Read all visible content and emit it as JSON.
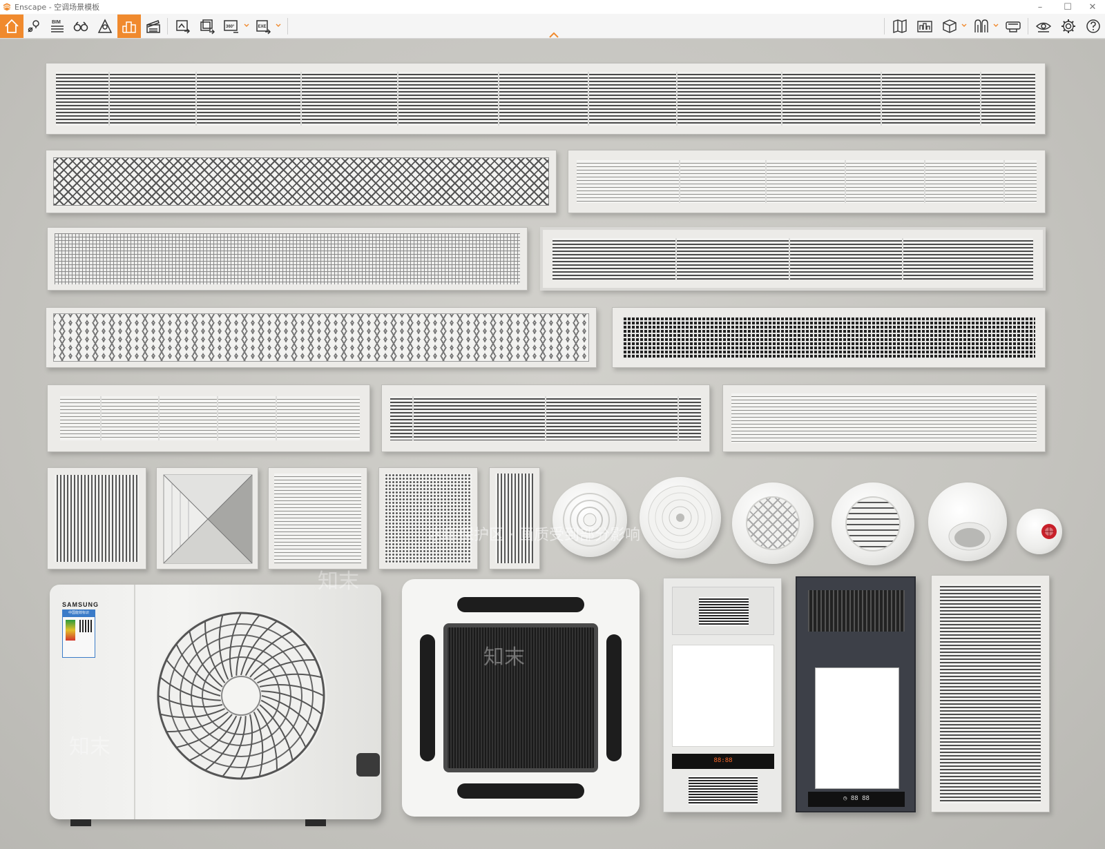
{
  "window": {
    "app_name": "Enscape",
    "separator": " - ",
    "project_name": "空调场景模板",
    "minimize": "–",
    "maximize": "☐",
    "close": "✕"
  },
  "toolbar": {
    "bim_label": "BIM",
    "left_tools": [
      {
        "name": "home",
        "icon": "home-icon",
        "active": true
      },
      {
        "name": "views",
        "icon": "location-pin-icon",
        "active": false
      },
      {
        "name": "bim-info",
        "icon": "bim-list-icon",
        "active": false
      },
      {
        "name": "walk-mode",
        "icon": "binoculars-icon",
        "active": false
      },
      {
        "name": "asset-library",
        "icon": "asset-library-icon",
        "active": false
      },
      {
        "name": "material-editor",
        "icon": "buildings-icon",
        "active": true
      },
      {
        "name": "video-editor",
        "icon": "clapperboard-icon",
        "active": false
      },
      {
        "name": "screenshot",
        "icon": "image-export-icon",
        "active": false
      },
      {
        "name": "batch-render",
        "icon": "batch-render-icon",
        "active": false
      },
      {
        "name": "panorama",
        "icon": "panorama-360-icon",
        "active": false
      },
      {
        "name": "exe-export",
        "icon": "exe-export-icon",
        "active": false
      }
    ],
    "panorama_label": "360°",
    "exe_label": "EXE",
    "right_tools": [
      {
        "name": "map",
        "icon": "map-icon"
      },
      {
        "name": "site-context",
        "icon": "site-context-icon"
      },
      {
        "name": "cube",
        "icon": "cube-icon"
      },
      {
        "name": "collaborative",
        "icon": "pillars-icon"
      },
      {
        "name": "vr-headset",
        "icon": "vr-headset-icon"
      },
      {
        "name": "visibility",
        "icon": "eye-icon"
      },
      {
        "name": "settings",
        "icon": "gear-icon"
      },
      {
        "name": "help",
        "icon": "help-icon"
      }
    ]
  },
  "scene": {
    "outdoor_unit_brand": "SAMSUNG",
    "energy_label_title": "中国能效标识",
    "bath_heater_display": "88:88",
    "panel_display": "◷ 88 88",
    "watermark_text": "知末",
    "watermark_notice": "水印保护区 · 画质受到部分影响",
    "colors": {
      "accent": "#f08a2e",
      "wall": "#c9c8c3",
      "grille": "#ecebe8",
      "dark_panel": "#3d4048",
      "fire_red": "#c8202a"
    }
  }
}
